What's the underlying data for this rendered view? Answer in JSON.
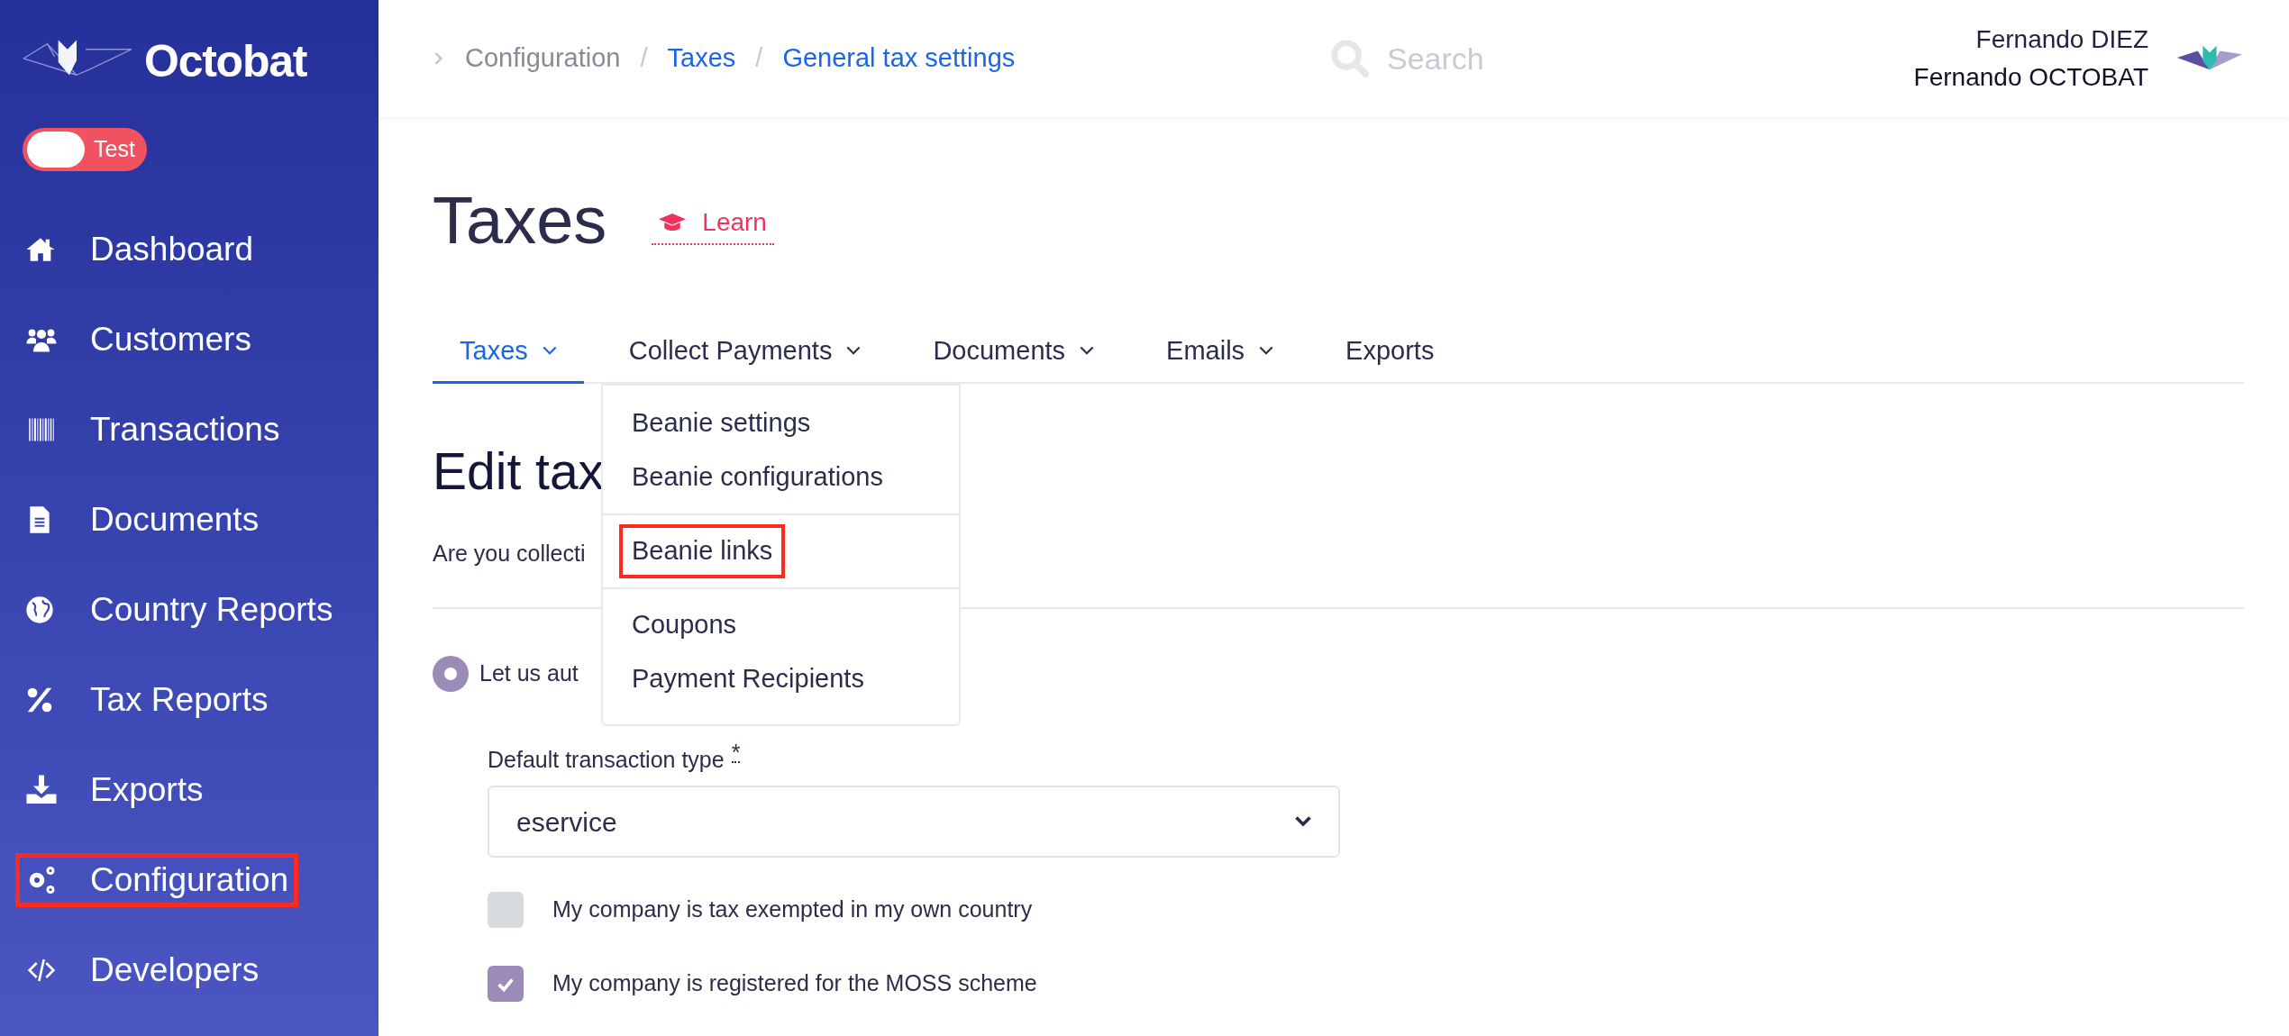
{
  "sidebar": {
    "brand": "Octobat",
    "mode_toggle": {
      "label": "Test",
      "on": false
    },
    "items": [
      {
        "kind": "home",
        "label": "Dashboard",
        "highlighted": false
      },
      {
        "kind": "users",
        "label": "Customers",
        "highlighted": false
      },
      {
        "kind": "barcode",
        "label": "Transactions",
        "highlighted": false
      },
      {
        "kind": "document",
        "label": "Documents",
        "highlighted": false
      },
      {
        "kind": "globe",
        "label": "Country Reports",
        "highlighted": false
      },
      {
        "kind": "percent",
        "label": "Tax Reports",
        "highlighted": false
      },
      {
        "kind": "download",
        "label": "Exports",
        "highlighted": false
      },
      {
        "kind": "gears",
        "label": "Configuration",
        "highlighted": true
      },
      {
        "kind": "code",
        "label": "Developers",
        "highlighted": false
      }
    ]
  },
  "topbar": {
    "separators": [
      "/",
      "/"
    ],
    "breadcrumb": [
      {
        "label": "Configuration",
        "link": false
      },
      {
        "label": "Taxes",
        "link": true
      },
      {
        "label": "General tax settings",
        "link": true
      }
    ],
    "search": {
      "placeholder": "Search"
    },
    "user": {
      "name": "Fernando DIEZ",
      "account": "Fernando OCTOBAT"
    }
  },
  "page": {
    "title": "Taxes",
    "learn_link": "Learn",
    "tabs": [
      {
        "label": "Taxes",
        "selected": true,
        "has_menu": true
      },
      {
        "label": "Collect Payments",
        "selected": false,
        "has_menu": true
      },
      {
        "label": "Documents",
        "selected": false,
        "has_menu": true
      },
      {
        "label": "Emails",
        "selected": false,
        "has_menu": true
      },
      {
        "label": "Exports",
        "selected": false,
        "has_menu": false
      }
    ],
    "dropdown": {
      "groups": [
        [
          {
            "label": "Beanie settings",
            "highlighted": false
          },
          {
            "label": "Beanie configurations",
            "highlighted": false
          }
        ],
        [
          {
            "label": "Beanie links",
            "highlighted": true
          }
        ],
        [
          {
            "label": "Coupons",
            "highlighted": false
          },
          {
            "label": "Payment Recipients",
            "highlighted": false
          }
        ]
      ]
    },
    "section_title": "Edit tax",
    "question": "Are you collecti",
    "radio": {
      "label": "Let us aut",
      "selected": true
    },
    "transaction_type": {
      "label": "Default transaction type",
      "required_mark": "*",
      "value": "eservice"
    },
    "checkboxes": [
      {
        "label": "My company is tax exempted in my own country",
        "checked": false
      },
      {
        "label": "My company is registered for the MOSS scheme",
        "checked": true
      }
    ]
  }
}
